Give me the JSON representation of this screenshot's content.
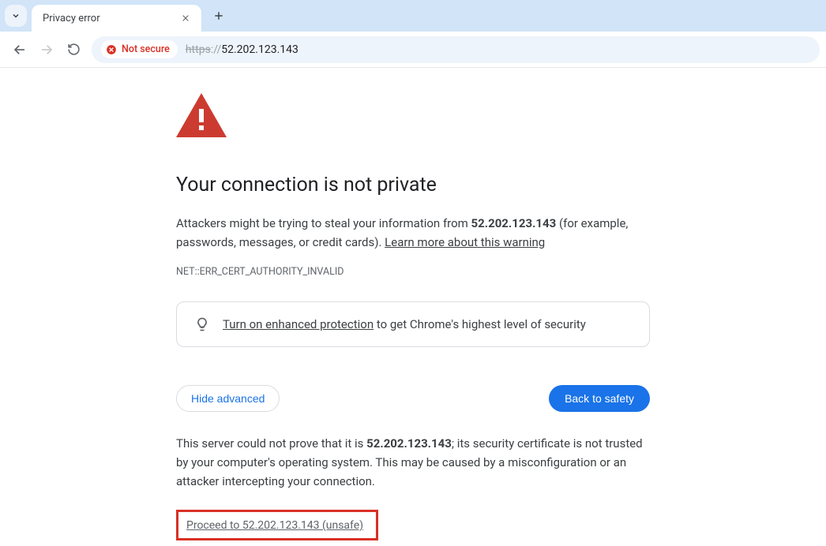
{
  "tab": {
    "title": "Privacy error"
  },
  "address": {
    "not_secure_label": "Not secure",
    "scheme": "https",
    "host_prefix": "://",
    "host": "52.202.123.143"
  },
  "page": {
    "headline": "Your connection is not private",
    "body_prefix": "Attackers might be trying to steal your information from ",
    "host": "52.202.123.143",
    "body_suffix": " (for example, passwords, messages, or credit cards). ",
    "learn_more": "Learn more about this warning",
    "error_code": "NET::ERR_CERT_AUTHORITY_INVALID",
    "promo_link": "Turn on enhanced protection",
    "promo_suffix": " to get Chrome's highest level of security",
    "hide_advanced": "Hide advanced",
    "back_to_safety": "Back to safety",
    "advanced_prefix": "This server could not prove that it is ",
    "advanced_suffix": "; its security certificate is not trusted by your computer's operating system. This may be caused by a misconfiguration or an attacker intercepting your connection.",
    "proceed_text": "Proceed to 52.202.123.143 (unsafe)"
  }
}
